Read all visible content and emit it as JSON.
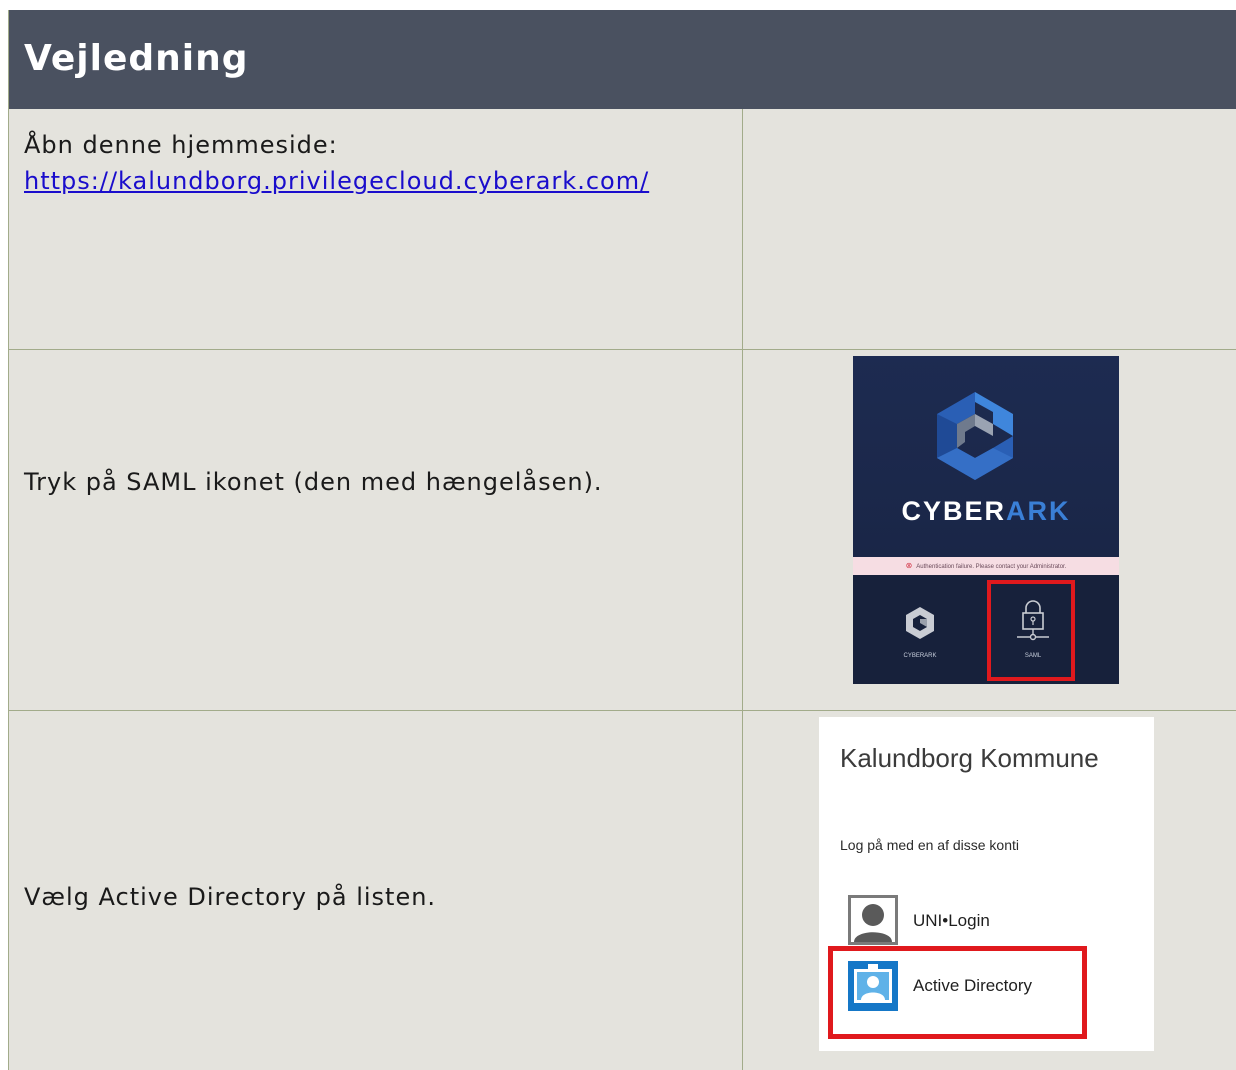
{
  "header": {
    "title": "Vejledning"
  },
  "rows": [
    {
      "text": "Åbn denne hjemmeside:",
      "link": "https://kalundborg.privilegecloud.cyberark.com/"
    },
    {
      "text": "Tryk på SAML ikonet (den med hængelåsen)."
    },
    {
      "text": "Vælg Active Directory på listen."
    }
  ],
  "cyberark_screenshot": {
    "brand_main": "CYBER",
    "brand_accent": "ARK",
    "error_message": "Authentication failure. Please contact your Administrator.",
    "options": [
      {
        "label": "CYBERARK",
        "icon": "cyberark-logo-icon"
      },
      {
        "label": "SAML",
        "icon": "padlock-icon"
      }
    ]
  },
  "login_screenshot": {
    "title": "Kalundborg Kommune",
    "subtitle": "Log på med en af disse konti",
    "accounts": [
      {
        "label": "UNI•Login",
        "icon": "person-icon"
      },
      {
        "label": "Active Directory",
        "icon": "id-badge-icon"
      }
    ]
  },
  "colors": {
    "header_bg": "#4a5160",
    "cell_bg": "#e4e3dd",
    "highlight": "#e0191d",
    "cyberark_bg": "#1a2647",
    "cyberark_accent": "#3a7fd6"
  }
}
